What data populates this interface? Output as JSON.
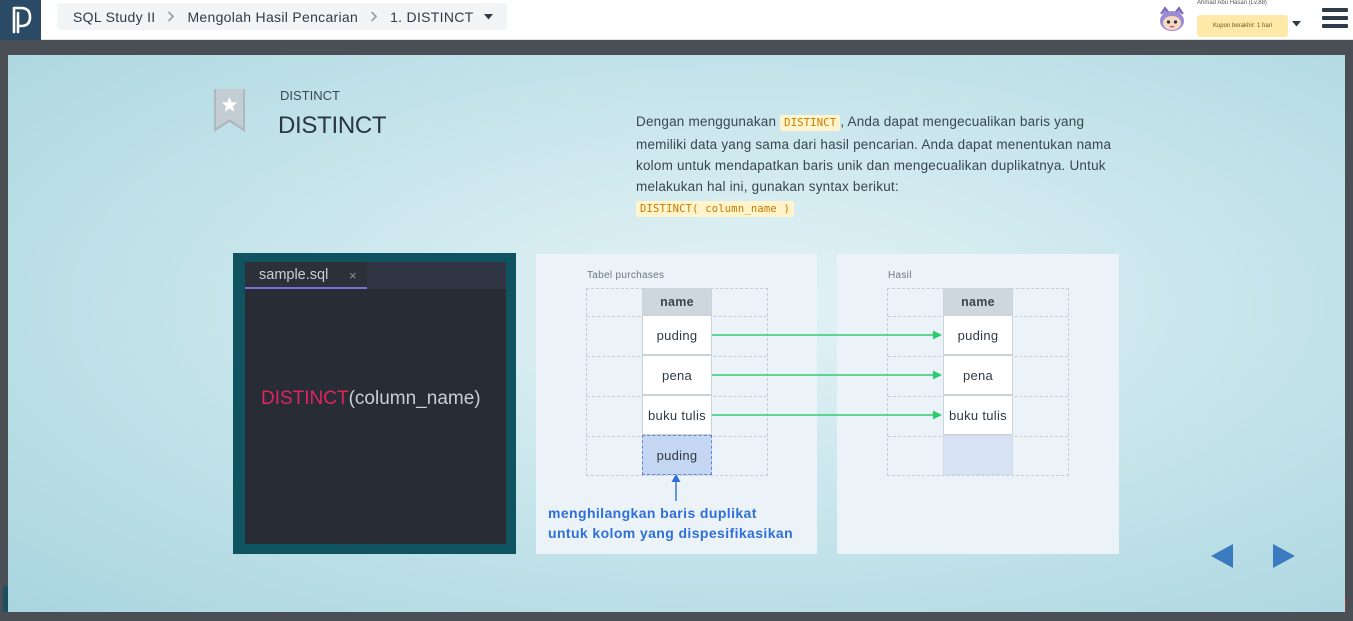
{
  "header": {
    "breadcrumb": [
      "SQL Study II",
      "Mengolah Hasil Pencarian",
      "1. DISTINCT"
    ],
    "user_name": "Ahmad Abu Hasan (Lv.88)",
    "coupon": "Kupon berakhir: 1 hari"
  },
  "slide": {
    "subtitle": "DISTINCT",
    "title": "DISTINCT",
    "desc_1": "Dengan menggunakan ",
    "desc_code_1": "DISTINCT",
    "desc_2": ", Anda dapat mengecualikan baris yang memiliki data yang sama dari hasil pencarian. Anda dapat menentukan nama kolom untuk mendapatkan baris unik dan mengecualikan duplikatnya. Untuk melakukan hal ini, gunakan syntax berikut:",
    "desc_code_2": "DISTINCT( column_name )"
  },
  "editor": {
    "tab": "sample.sql",
    "tab_close": "×",
    "code_keyword": "DISTINCT",
    "code_rest": "(column_name)"
  },
  "diagram": {
    "left_label": "Tabel purchases",
    "right_label": "Hasil",
    "header": "name",
    "left_rows": [
      "puding",
      "pena",
      "buku tulis",
      "puding"
    ],
    "right_rows": [
      "puding",
      "pena",
      "buku tulis",
      ""
    ],
    "note_1": "menghilangkan baris duplikat",
    "note_2": "untuk kolom yang dispesifikasikan"
  },
  "colors": {
    "accent_green": "#2ecc71",
    "note_blue": "#2f6fd8",
    "keyword": "#e0245e"
  }
}
